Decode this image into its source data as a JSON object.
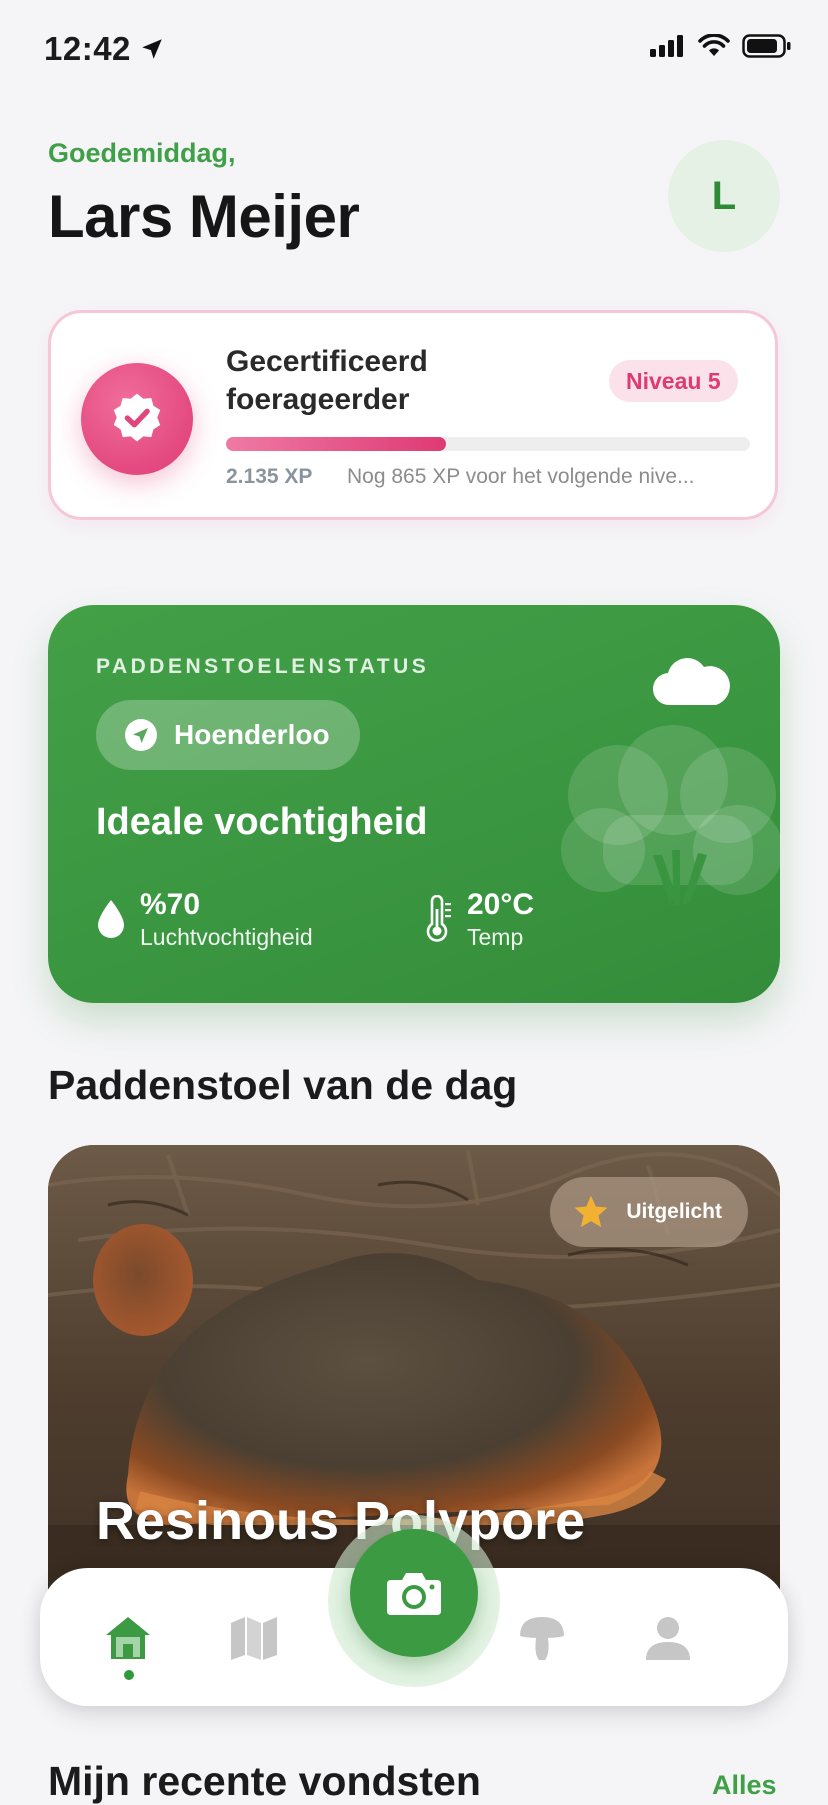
{
  "status_bar": {
    "time": "12:42"
  },
  "header": {
    "greeting": "Goedemiddag,",
    "name": "Lars Meijer",
    "avatar_initial": "L"
  },
  "level": {
    "title": "Gecertificeerd foerageerder",
    "level_label": "Niveau 5",
    "xp": "2.135 XP",
    "progress_fraction": 0.42,
    "next_level_note": "Nog 865 XP voor het volgende nive..."
  },
  "mushroom_status": {
    "label": "PADDENSTOELENSTATUS",
    "location": "Hoenderloo",
    "headline": "Ideale vochtigheid",
    "humidity_value": "%70",
    "humidity_label": "Luchtvochtigheid",
    "temp_value": "20°C",
    "temp_label": "Temp",
    "weather_icon": "cloud-icon"
  },
  "daily_mushroom": {
    "section_title": "Paddenstoel van de dag",
    "featured_label": "Uitgelicht",
    "name": "Resinous Polypore"
  },
  "recent": {
    "title": "Mijn recente vondsten",
    "all_link": "Alles"
  },
  "bottom_nav": {
    "items": [
      "home-icon",
      "map-icon",
      "camera-icon",
      "mushroom-icon",
      "profile-icon"
    ],
    "active": "home"
  },
  "colors": {
    "accent_green": "#3fa047",
    "accent_pink": "#de3a73",
    "background": "#f5f5f7"
  }
}
